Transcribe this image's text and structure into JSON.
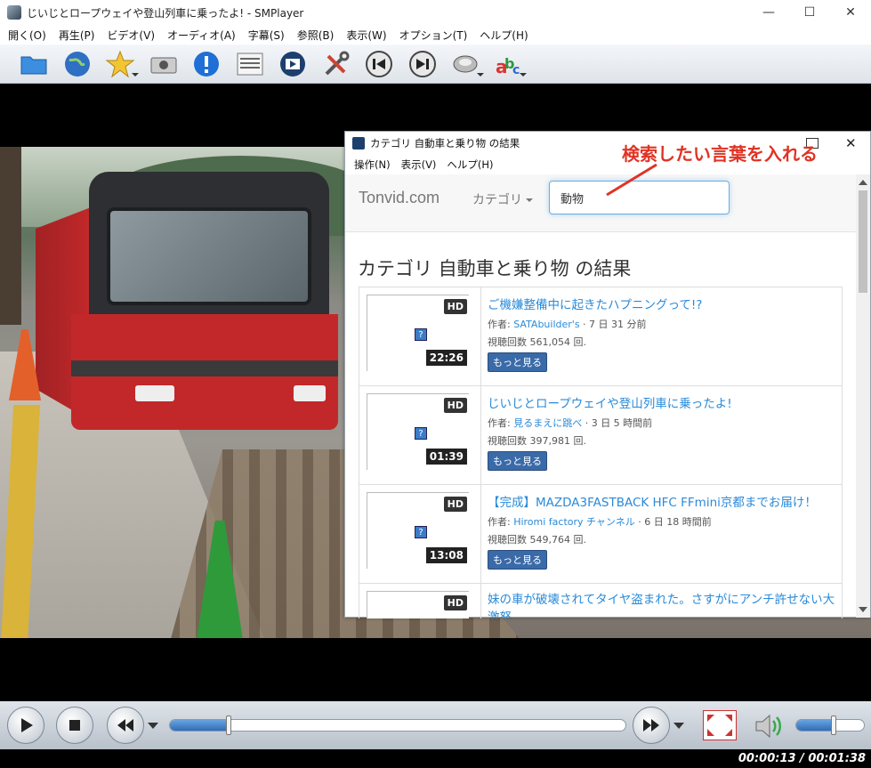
{
  "window": {
    "title": "じいじとロープウェイや登山列車に乗ったよ! - SMPlayer",
    "minimize": "—",
    "maximize": "☐",
    "close": "✕"
  },
  "menu": [
    "開く(O)",
    "再生(P)",
    "ビデオ(V)",
    "オーディオ(A)",
    "字幕(S)",
    "参照(B)",
    "表示(W)",
    "オプション(T)",
    "ヘルプ(H)"
  ],
  "toolbar_icons": [
    "open-folder-icon",
    "globe-icon",
    "favorites-star-icon",
    "screenshot-camera-icon",
    "info-icon",
    "playlist-icon",
    "youtube-browser-icon",
    "preferences-tools-icon",
    "previous-icon",
    "next-icon",
    "audio-icon",
    "subtitles-icon"
  ],
  "dialog": {
    "title": "カテゴリ 自動車と乗り物 の結果",
    "close": "✕",
    "menu": [
      "操作(N)",
      "表示(V)",
      "ヘルプ(H)"
    ],
    "brand": "Tonvid.com",
    "category_label": "カテゴリ",
    "search_value": "動物",
    "annotation": "検索したい言葉を入れる",
    "results_heading": "カテゴリ 自動車と乗り物 の結果",
    "more_label": "もっと見る",
    "results": [
      {
        "title": "ご機嫌整備中に起きたハプニングって!?",
        "author_prefix": "作者: ",
        "author": "SATAbuilder's",
        "age": " · 7 日 31 分前",
        "views": "視聴回数 561,054 回.",
        "hd": "HD",
        "duration": "22:26"
      },
      {
        "title": "じいじとロープウェイや登山列車に乗ったよ!",
        "author_prefix": "作者: ",
        "author": "見るまえに跳べ",
        "age": " · 3 日 5 時間前",
        "views": "視聴回数 397,981 回.",
        "hd": "HD",
        "duration": "01:39"
      },
      {
        "title": "【完成】MAZDA3FASTBACK HFC FFmini京都までお届け！",
        "author_prefix": "作者: ",
        "author": "Hiromi factory チャンネル",
        "age": " · 6 日 18 時間前",
        "views": "視聴回数 549,764 回.",
        "hd": "HD",
        "duration": "13:08"
      },
      {
        "title": "妹の車が破壊されてタイヤ盗まれた。さすがにアンチ許せない大激怒",
        "author_prefix": "",
        "author": "",
        "age": "",
        "views": "",
        "hd": "HD",
        "duration": ""
      }
    ]
  },
  "player": {
    "time": "00:00:13 / 00:01:38",
    "progress_fraction": 0.13,
    "volume_fraction": 0.55
  },
  "colors": {
    "annotation": "#e03324",
    "link": "#2a8ad8",
    "button": "#3a6aa8"
  }
}
